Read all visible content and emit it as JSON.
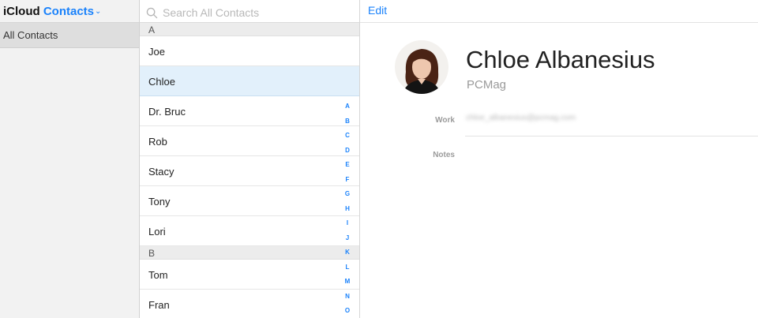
{
  "groups": {
    "brand": "iCloud",
    "app_name": "Contacts",
    "items": [
      {
        "label": "All Contacts"
      }
    ]
  },
  "list": {
    "search_placeholder": "Search All Contacts",
    "sections": [
      {
        "letter": "A",
        "contacts": [
          "Joe",
          "Chloe",
          "Dr. Bruc",
          "Rob",
          "Stacy",
          "Tony",
          "Lori"
        ]
      },
      {
        "letter": "B",
        "contacts": [
          "Tom",
          "Fran"
        ]
      }
    ],
    "selected": "Chloe",
    "index_letters": [
      "A",
      "B",
      "C",
      "D",
      "E",
      "F",
      "G",
      "H",
      "I",
      "J",
      "K",
      "L",
      "M",
      "N",
      "O"
    ]
  },
  "detail": {
    "edit_label": "Edit",
    "name": "Chloe Albanesius",
    "company": "PCMag",
    "work_label": "Work",
    "work_value": "chloe_albanesius@pcmag.com",
    "notes_label": "Notes"
  },
  "colors": {
    "accent": "#1a82fb",
    "selected_row": "#e2f0fb",
    "sidebar_bg": "#f2f2f2"
  }
}
